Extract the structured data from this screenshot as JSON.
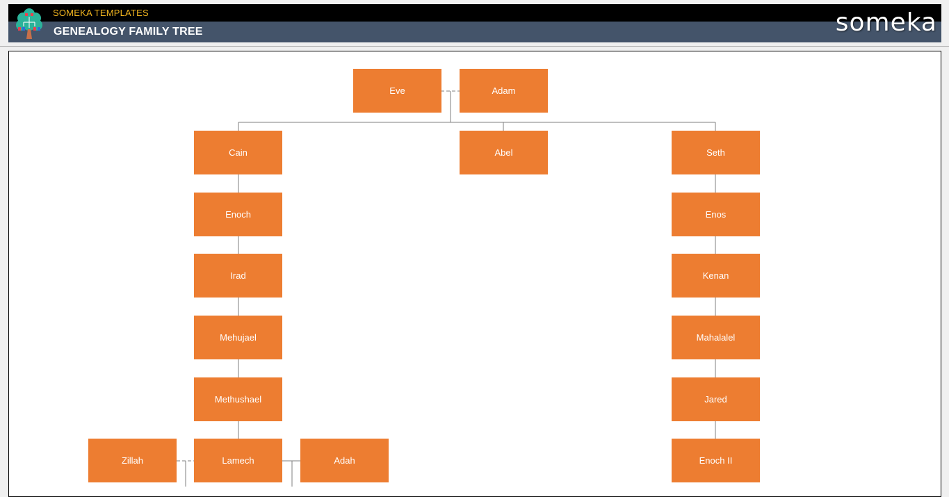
{
  "header": {
    "brand_small": "SOMEKA TEMPLATES",
    "title": "GENEALOGY FAMILY TREE",
    "logo_text": "someka",
    "logo_icon": "family-tree-icon"
  },
  "colors": {
    "node_fill": "#ed7d31",
    "node_text": "#ffffff",
    "header_dark": "#000000",
    "header_slate": "#44546a",
    "brand_accent": "#f2b51f",
    "connector": "#7f7f7f"
  },
  "tree": {
    "nodes": [
      {
        "id": "eve",
        "label": "Eve"
      },
      {
        "id": "adam",
        "label": "Adam"
      },
      {
        "id": "cain",
        "label": "Cain"
      },
      {
        "id": "abel",
        "label": "Abel"
      },
      {
        "id": "seth",
        "label": "Seth"
      },
      {
        "id": "enoch",
        "label": "Enoch"
      },
      {
        "id": "irad",
        "label": "Irad"
      },
      {
        "id": "mehujael",
        "label": "Mehujael"
      },
      {
        "id": "methushael",
        "label": "Methushael"
      },
      {
        "id": "zillah",
        "label": "Zillah"
      },
      {
        "id": "lamech",
        "label": "Lamech"
      },
      {
        "id": "adah",
        "label": "Adah"
      },
      {
        "id": "enos",
        "label": "Enos"
      },
      {
        "id": "kenan",
        "label": "Kenan"
      },
      {
        "id": "mahalalel",
        "label": "Mahalalel"
      },
      {
        "id": "jared",
        "label": "Jared"
      },
      {
        "id": "enoch2",
        "label": "Enoch II"
      }
    ],
    "couples": [
      [
        "eve",
        "adam"
      ],
      [
        "zillah",
        "lamech"
      ],
      [
        "lamech",
        "adah"
      ]
    ],
    "children": [
      {
        "parents": [
          "eve",
          "adam"
        ],
        "children": [
          "cain",
          "abel",
          "seth"
        ]
      },
      {
        "parent": "cain",
        "children": [
          "enoch"
        ]
      },
      {
        "parent": "enoch",
        "children": [
          "irad"
        ]
      },
      {
        "parent": "irad",
        "children": [
          "mehujael"
        ]
      },
      {
        "parent": "mehujael",
        "children": [
          "methushael"
        ]
      },
      {
        "parent": "methushael",
        "children": [
          "lamech"
        ]
      },
      {
        "parent": "seth",
        "children": [
          "enos"
        ]
      },
      {
        "parent": "enos",
        "children": [
          "kenan"
        ]
      },
      {
        "parent": "kenan",
        "children": [
          "mahalalel"
        ]
      },
      {
        "parent": "mahalalel",
        "children": [
          "jared"
        ]
      },
      {
        "parent": "jared",
        "children": [
          "enoch2"
        ]
      }
    ]
  }
}
